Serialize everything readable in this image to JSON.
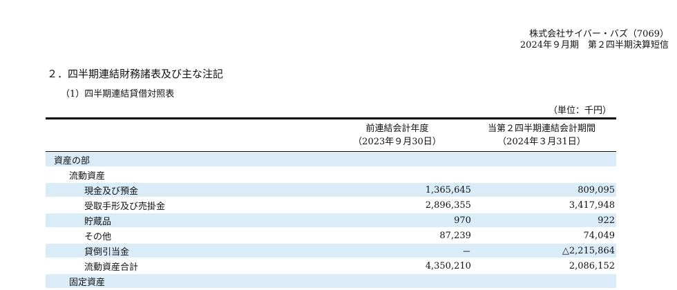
{
  "header": {
    "company": "株式会社サイバー・バズ（7069）",
    "period": "2024年９月期　第２四半期決算短信"
  },
  "section_title": "２．四半期連結財務諸表及び主な注記",
  "subsection_title": "（1）四半期連結貸借対照表",
  "unit": "（単位：千円）",
  "columns": {
    "prev": {
      "title": "前連結会計年度",
      "date": "（2023年９月30日）"
    },
    "curr": {
      "title": "当第２四半期連結会計期間",
      "date": "（2024年３月31日）"
    }
  },
  "rows": [
    {
      "label": "資産の部",
      "prev": "",
      "curr": ""
    },
    {
      "label": "流動資産",
      "prev": "",
      "curr": ""
    },
    {
      "label": "現金及び預金",
      "prev": "1,365,645",
      "curr": "809,095"
    },
    {
      "label": "受取手形及び売掛金",
      "prev": "2,896,355",
      "curr": "3,417,948"
    },
    {
      "label": "貯蔵品",
      "prev": "970",
      "curr": "922"
    },
    {
      "label": "その他",
      "prev": "87,239",
      "curr": "74,049"
    },
    {
      "label": "貸倒引当金",
      "prev": "－",
      "curr": "△2,215,864"
    },
    {
      "label": "流動資産合計",
      "prev": "4,350,210",
      "curr": "2,086,152"
    },
    {
      "label": "固定資産",
      "prev": "",
      "curr": ""
    }
  ]
}
